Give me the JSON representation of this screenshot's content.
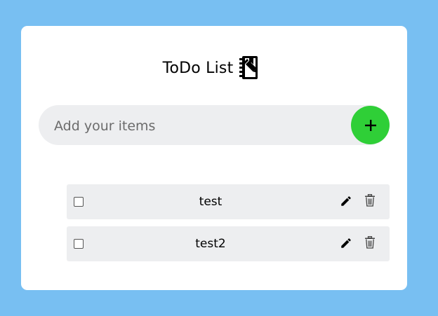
{
  "header": {
    "title": "ToDo List"
  },
  "input": {
    "placeholder": "Add your items",
    "value": ""
  },
  "add_button": {
    "icon": "plus-icon",
    "color": "#2fcf37"
  },
  "items": [
    {
      "text": "test",
      "checked": false
    },
    {
      "text": "test2",
      "checked": false
    }
  ],
  "colors": {
    "background": "#78bff2",
    "card": "#ffffff",
    "item_bg": "#edeef0",
    "accent": "#2fcf37"
  }
}
